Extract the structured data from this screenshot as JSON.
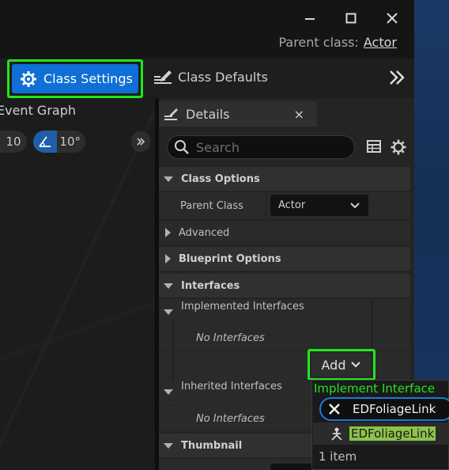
{
  "window": {
    "minimize_icon": "minimize-icon",
    "maximize_icon": "maximize-icon",
    "close_icon": "close-icon",
    "parent_class_label": "Parent class:",
    "parent_class_value": "Actor"
  },
  "toolbar": {
    "class_settings_label": "Class Settings",
    "class_defaults_label": "Class Defaults",
    "highlight_color": "#22e51d",
    "accent_color": "#0f6fd6"
  },
  "graph": {
    "tab_label": "Event Graph",
    "grid_snap": "10",
    "rotation_snap": "10°"
  },
  "details": {
    "tab_label": "Details",
    "close_glyph": "×",
    "search_placeholder": "Search",
    "sections": {
      "class_options": "Class Options",
      "parent_class_row_label": "Parent Class",
      "parent_class_value": "Actor",
      "advanced": "Advanced",
      "blueprint_options": "Blueprint Options",
      "interfaces": "Interfaces",
      "implemented_interfaces": "Implemented Interfaces",
      "no_interfaces_1": "No Interfaces",
      "add_label": "Add",
      "inherited_interfaces": "Inherited Interfaces",
      "no_interfaces_2": "No Interfaces",
      "thumbnail": "Thumbnail"
    }
  },
  "popup": {
    "title": "Implement Interface",
    "search_value": "EDFoliageLink",
    "result_label": "EDFoliageLink",
    "count_label": "1 item"
  }
}
